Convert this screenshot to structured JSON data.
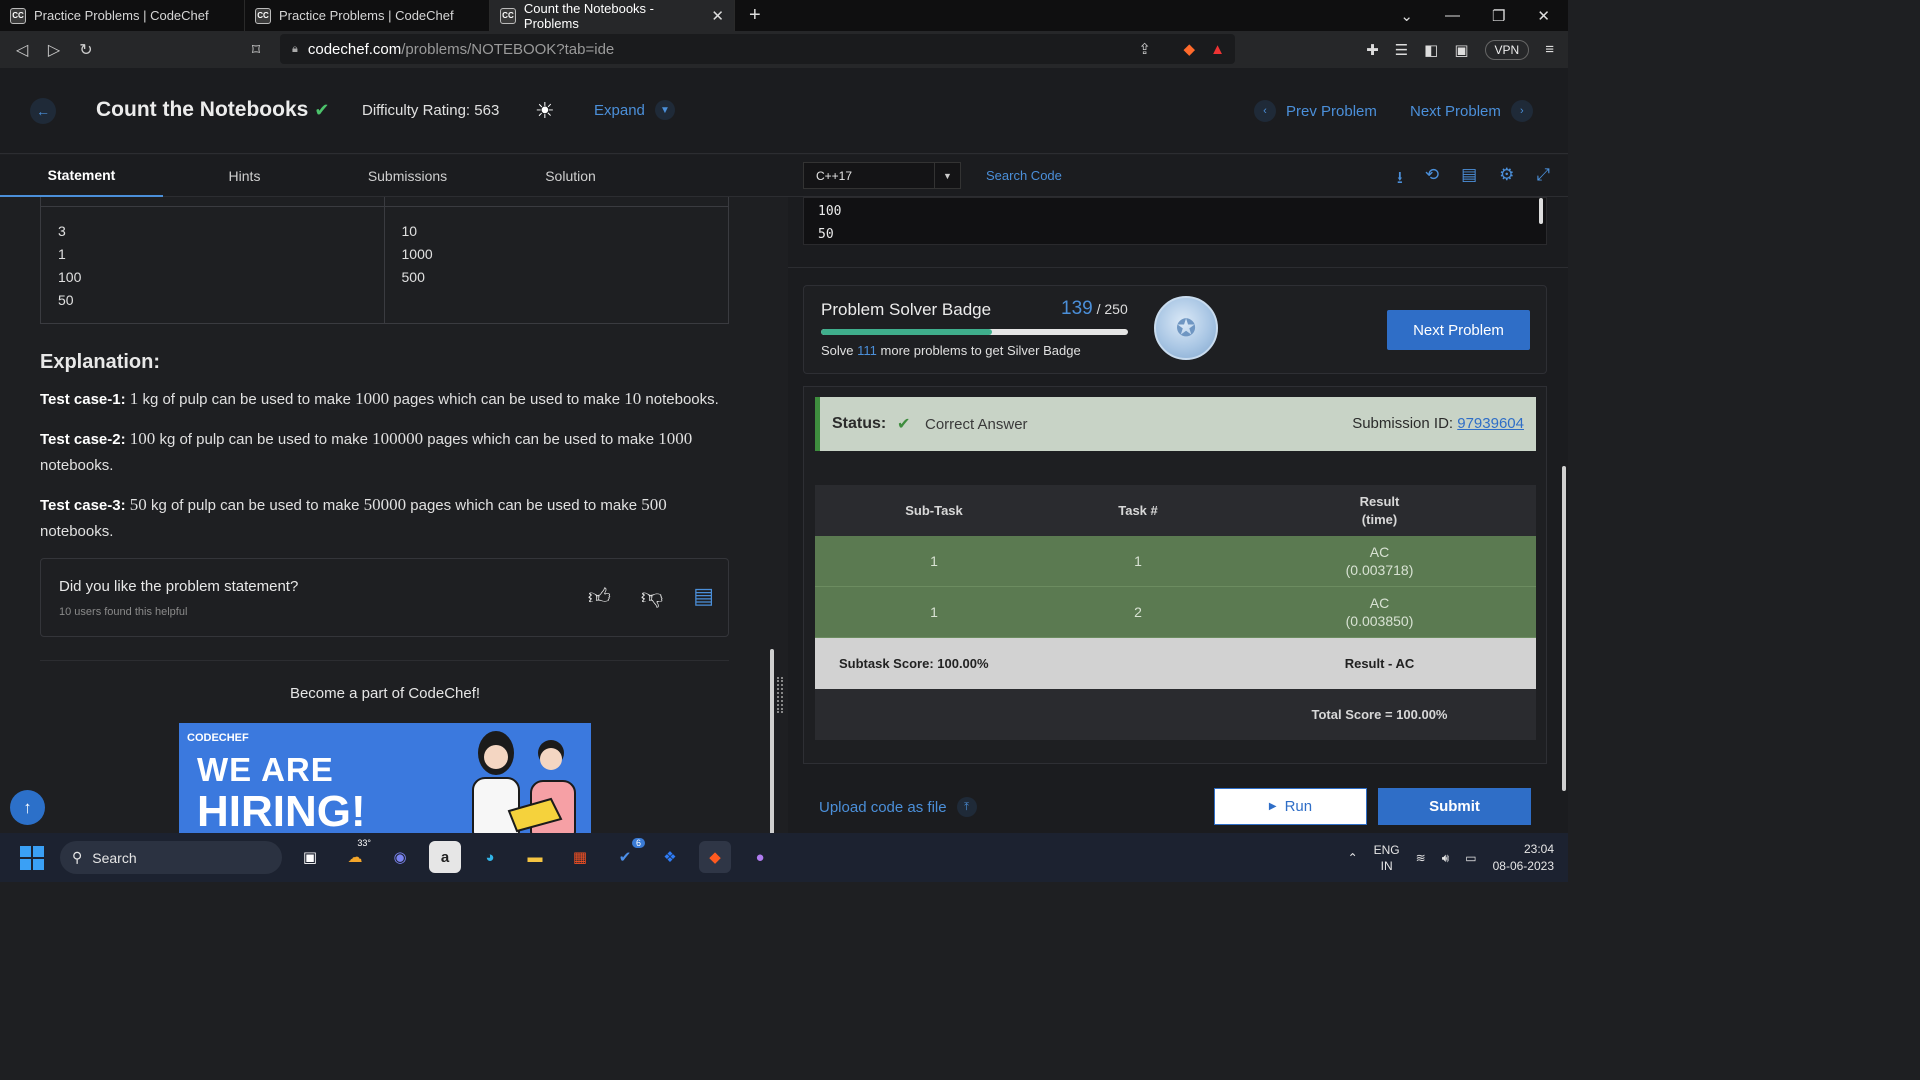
{
  "browser": {
    "tabs": [
      {
        "favicon": "CC",
        "title": "Practice Problems | CodeChef",
        "active": false
      },
      {
        "favicon": "CC",
        "title": "Practice Problems | CodeChef",
        "active": false
      },
      {
        "favicon": "CC",
        "title": "Count the Notebooks - Problems",
        "active": true
      }
    ],
    "new_tab": "+",
    "url_host": "codechef.com",
    "url_path": "/problems/NOTEBOOK?tab=ide",
    "vpn_label": "VPN"
  },
  "header": {
    "title": "Count the Notebooks",
    "difficulty": "Difficulty Rating: 563",
    "expand": "Expand",
    "prev": "Prev Problem",
    "next": "Next Problem"
  },
  "problem_tabs": [
    "Statement",
    "Hints",
    "Submissions",
    "Solution"
  ],
  "sample": {
    "input": [
      "3",
      "1",
      "100",
      "50"
    ],
    "output": [
      "10",
      "1000",
      "500"
    ]
  },
  "explanation": {
    "title": "Explanation:",
    "cases": [
      {
        "label": "Test case-1:",
        "kg": "1",
        "mid1": " kg of pulp can be used to make ",
        "pages": "1000",
        "mid2": " pages which can be used to make ",
        "books": "10",
        "end": " notebooks."
      },
      {
        "label": "Test case-2:",
        "kg": "100",
        "mid1": " kg of pulp can be used to make ",
        "pages": "100000",
        "mid2": " pages which can be used to make ",
        "books": "1000",
        "end": " notebooks."
      },
      {
        "label": "Test case-3:",
        "kg": "50",
        "mid1": " kg of pulp can be used to make ",
        "pages": "50000",
        "mid2": " pages which can be used to make ",
        "books": "500",
        "end": " notebooks."
      }
    ]
  },
  "feedback": {
    "question": "Did you like the problem statement?",
    "helpful": "10 users found this helpful"
  },
  "promo": {
    "become": "Become a part of CodeChef!",
    "brand": "CODECHEF",
    "line1": "WE ARE",
    "line2": "HIRING!"
  },
  "editor": {
    "language": "C++17",
    "search": "Search Code",
    "output_lines": [
      "100",
      "50"
    ]
  },
  "badge": {
    "title": "Problem Solver Badge",
    "solved": "139",
    "total": "/ 250",
    "progress": 0.556,
    "sub_prefix": "Solve ",
    "sub_count": "111",
    "sub_suffix": " more problems to get Silver Badge",
    "next_button": "Next Problem"
  },
  "result": {
    "status_label": "Status:",
    "status_value": "Correct Answer",
    "submission_label": "Submission ID: ",
    "submission_id": "97939604",
    "columns": [
      "Sub-Task",
      "Task #",
      "Result",
      "(time)"
    ],
    "rows": [
      {
        "subtask": "1",
        "task": "1",
        "result": "AC",
        "time": "(0.003718)"
      },
      {
        "subtask": "1",
        "task": "2",
        "result": "AC",
        "time": "(0.003850)"
      }
    ],
    "subtask_score": "Subtask Score: 100.00%",
    "result_summary": "Result - AC",
    "total_score": "Total Score = 100.00%"
  },
  "actions": {
    "upload": "Upload code as file",
    "run": "Run",
    "submit": "Submit"
  },
  "taskbar": {
    "search": "Search",
    "weather_temp": "33°",
    "steam_badge": "6",
    "lang_top": "ENG",
    "lang_bottom": "IN",
    "time": "23:04",
    "date": "08-06-2023"
  },
  "colors": {
    "accent": "#4b8fd9",
    "success": "#3e8d3e",
    "ac_row": "#5b7a51",
    "button": "#2f6ec7"
  }
}
